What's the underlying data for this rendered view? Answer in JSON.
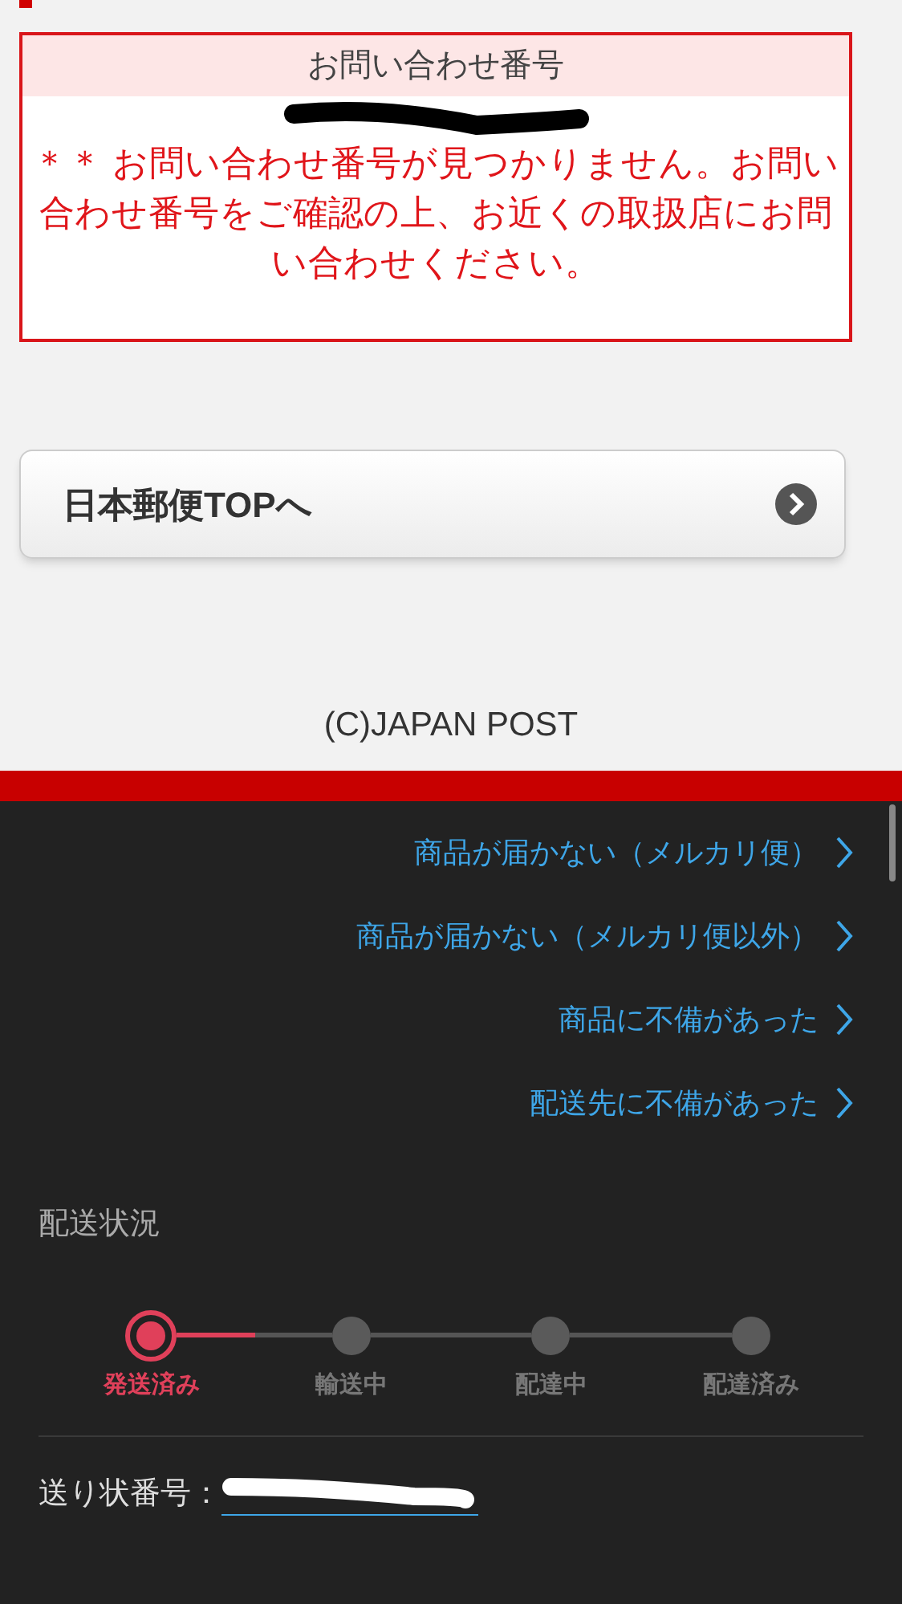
{
  "inquiry_box": {
    "header": "お問い合わせ番号",
    "message": "＊＊ お問い合わせ番号が見つかりません。お問い合わせ番号をご確認の上、お近くの取扱店にお問い合わせください。"
  },
  "top_button": {
    "label": "日本郵便TOPへ"
  },
  "copyright": "(C)JAPAN POST",
  "help_links": [
    {
      "label": "商品が届かない（メルカリ便）"
    },
    {
      "label": "商品が届かない（メルカリ便以外）"
    },
    {
      "label": "商品に不備があった"
    },
    {
      "label": "配送先に不備があった"
    }
  ],
  "shipping_status": {
    "title": "配送状況",
    "progress": {
      "level": 0.5
    },
    "steps": [
      {
        "label": "発送済み",
        "selected": true
      },
      {
        "label": "輸送中",
        "selected": false
      },
      {
        "label": "配達中",
        "selected": false
      },
      {
        "label": "配達済み",
        "selected": false
      }
    ]
  },
  "tracking": {
    "label": "送り状番号："
  }
}
